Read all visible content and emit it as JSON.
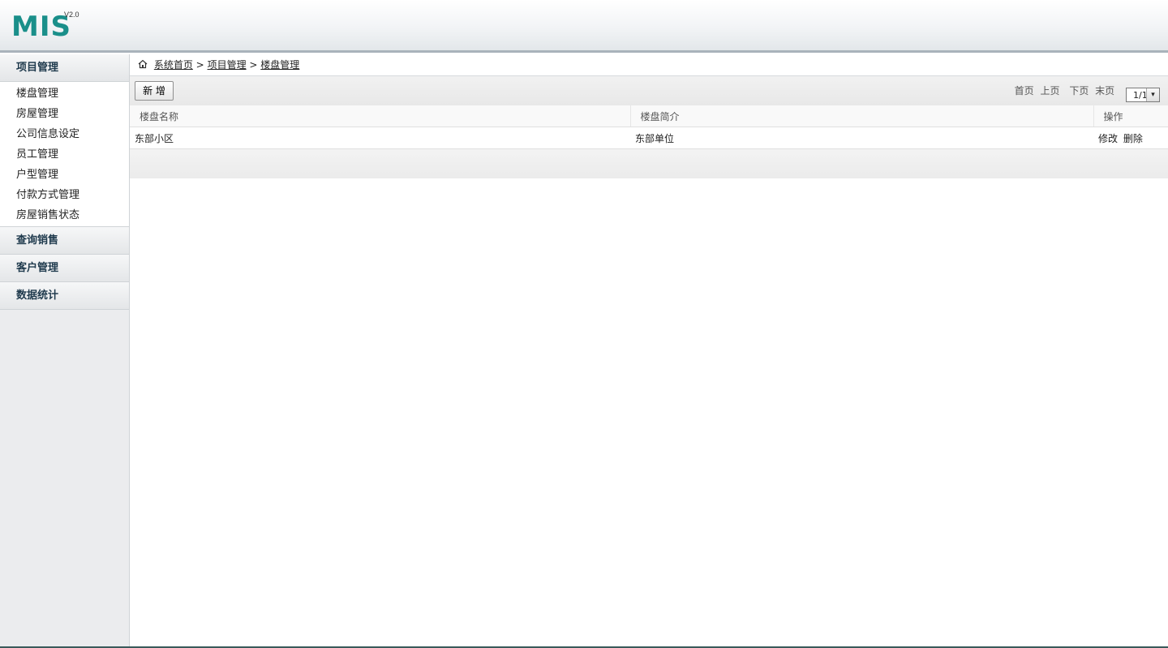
{
  "app": {
    "logo_text": "MIS",
    "version": "V2.0"
  },
  "sidebar": {
    "groups": [
      {
        "title": "项目管理",
        "items": [
          {
            "label": "楼盘管理"
          },
          {
            "label": "房屋管理"
          },
          {
            "label": "公司信息设定"
          },
          {
            "label": "员工管理"
          },
          {
            "label": "户型管理"
          },
          {
            "label": "付款方式管理"
          },
          {
            "label": "房屋销售状态"
          }
        ]
      },
      {
        "title": "查询销售"
      },
      {
        "title": "客户管理"
      },
      {
        "title": "数据统计"
      }
    ]
  },
  "breadcrumb": {
    "home": "系统首页",
    "sep": ">",
    "level1": "项目管理",
    "level2": "楼盘管理"
  },
  "toolbar": {
    "add_label": "新 增",
    "pager": {
      "first": "首页",
      "prev": "上页",
      "next": "下页",
      "last": "末页",
      "current": "1/1"
    }
  },
  "table": {
    "columns": [
      "楼盘名称",
      "楼盘简介",
      "操作"
    ],
    "rows": [
      {
        "name": "东部小区",
        "intro": "东部单位",
        "edit": "修改",
        "delete": "删除"
      }
    ]
  }
}
